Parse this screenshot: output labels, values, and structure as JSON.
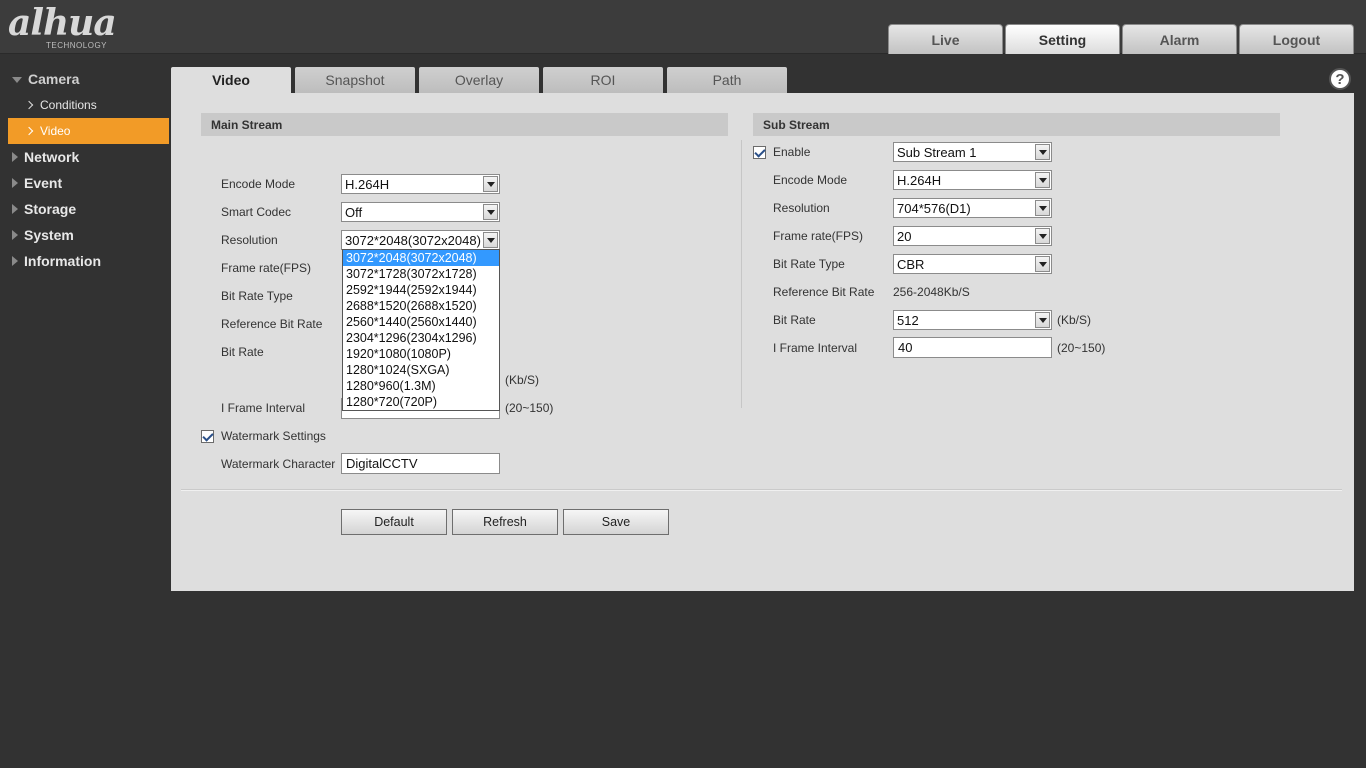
{
  "header": {
    "logo_text": "alhua",
    "logo_sub": "TECHNOLOGY",
    "nav": [
      "Live",
      "Setting",
      "Alarm",
      "Logout"
    ],
    "active_nav": "Setting"
  },
  "sidebar": {
    "camera": "Camera",
    "camera_items": [
      "Conditions",
      "Video"
    ],
    "groups": [
      "Network",
      "Event",
      "Storage",
      "System",
      "Information"
    ]
  },
  "tabs": [
    "Video",
    "Snapshot",
    "Overlay",
    "ROI",
    "Path"
  ],
  "help_icon": "?",
  "main_stream": {
    "title": "Main Stream",
    "encode_mode_label": "Encode Mode",
    "encode_mode": "H.264H",
    "smart_codec_label": "Smart Codec",
    "smart_codec": "Off",
    "resolution_label": "Resolution",
    "resolution": "3072*2048(3072x2048)",
    "frame_rate_label": "Frame rate(FPS)",
    "bit_rate_type_label": "Bit Rate Type",
    "ref_bit_rate_label": "Reference Bit Rate",
    "bit_rate_label": "Bit Rate",
    "bit_rate_unit": "(Kb/S)",
    "iframe_label": "I Frame Interval",
    "iframe_range": "(20~150)",
    "watermark_label": "Watermark Settings",
    "watermark_char_label": "Watermark Character",
    "watermark_char": "DigitalCCTV",
    "resolution_options": [
      "3072*2048(3072x2048)",
      "3072*1728(3072x1728)",
      "2592*1944(2592x1944)",
      "2688*1520(2688x1520)",
      "2560*1440(2560x1440)",
      "2304*1296(2304x1296)",
      "1920*1080(1080P)",
      "1280*1024(SXGA)",
      "1280*960(1.3M)",
      "1280*720(720P)"
    ]
  },
  "sub_stream": {
    "title": "Sub Stream",
    "enable_label": "Enable",
    "enable_value": "Sub Stream 1",
    "encode_mode_label": "Encode Mode",
    "encode_mode": "H.264H",
    "resolution_label": "Resolution",
    "resolution": "704*576(D1)",
    "frame_rate_label": "Frame rate(FPS)",
    "frame_rate": "20",
    "bit_rate_type_label": "Bit Rate Type",
    "bit_rate_type": "CBR",
    "ref_bit_rate_label": "Reference Bit Rate",
    "ref_bit_rate": "256-2048Kb/S",
    "bit_rate_label": "Bit Rate",
    "bit_rate": "512",
    "bit_rate_unit": "(Kb/S)",
    "iframe_label": "I Frame Interval",
    "iframe": "40",
    "iframe_range": "(20~150)"
  },
  "buttons": {
    "default": "Default",
    "refresh": "Refresh",
    "save": "Save"
  }
}
